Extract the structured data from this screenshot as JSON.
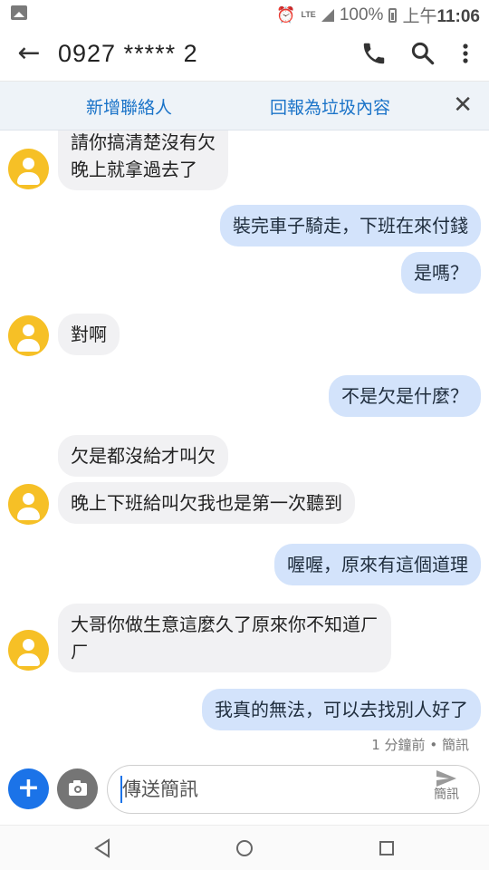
{
  "status_bar": {
    "network": "LTE",
    "battery": "100%",
    "time_prefix": "上午",
    "time": "11:06"
  },
  "header": {
    "title": "0927 ***** 2",
    "icons": [
      "back-arrow-icon",
      "phone-icon",
      "search-icon",
      "more-vert-icon"
    ]
  },
  "banner": {
    "add_contact": "新增聯絡人",
    "report_spam": "回報為垃圾內容",
    "close": "✕"
  },
  "messages": [
    {
      "direction": "in",
      "text": "請你搞清楚沒有欠\n晚上就拿過去了"
    },
    {
      "direction": "out",
      "text": "裝完車子騎走，下班在來付錢"
    },
    {
      "direction": "out",
      "text": "是嗎？"
    },
    {
      "direction": "in",
      "text": "對啊"
    },
    {
      "direction": "out",
      "text": "不是欠是什麼？"
    },
    {
      "direction": "in",
      "text": "欠是都沒給才叫欠"
    },
    {
      "direction": "in",
      "text": "晚上下班給叫欠我也是第一次聽到"
    },
    {
      "direction": "out",
      "text": "喔喔，原來有這個道理"
    },
    {
      "direction": "in",
      "text": "大哥你做生意這麼久了原來你不知道ㄏ\nㄏ"
    },
    {
      "direction": "out",
      "text": "我真的無法，可以去找別人好了"
    }
  ],
  "last_meta": {
    "time": "1 分鐘前",
    "separator": "•",
    "type": "簡訊"
  },
  "composer": {
    "placeholder": "傳送簡訊",
    "send_label": "簡訊",
    "icons": [
      "add-icon",
      "camera-icon",
      "send-icon"
    ]
  },
  "colors": {
    "incoming_bubble": "#f1f1f3",
    "outgoing_bubble": "#d3e3fb",
    "avatar": "#f6c026",
    "accent": "#1b73e8",
    "link": "#1a73c8"
  }
}
